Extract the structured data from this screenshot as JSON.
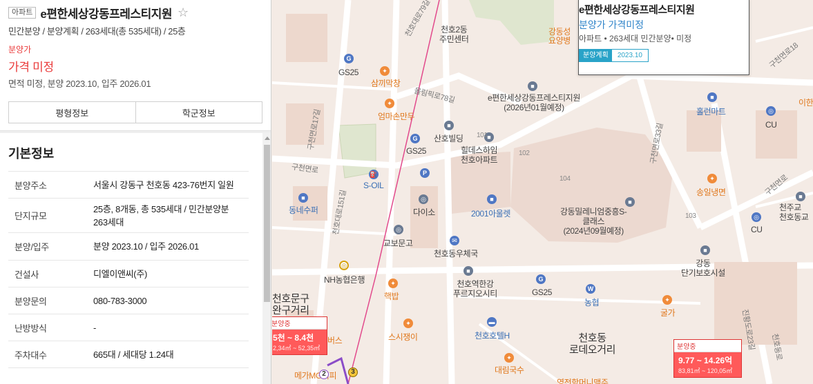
{
  "listing": {
    "type_badge": "아파트",
    "name": "e편한세상강동프레스티지원",
    "star_icon": "☆",
    "summary": "민간분양 / 분양계획 / 263세대(총 535세대) / 25층",
    "sale_label": "분양가",
    "price": "가격 미정",
    "info": "면적 미정, 분양 2023.10, 입주 2026.01"
  },
  "tabs": [
    "평형정보",
    "학군정보"
  ],
  "basic_info": {
    "title": "기본정보",
    "rows": [
      {
        "key": "분양주소",
        "value": "서울시 강동구 천호동 423-76번지 일원"
      },
      {
        "key": "단지규모",
        "value": "25층, 8개동, 총 535세대 / 민간분양분 263세대"
      },
      {
        "key": "분양/입주",
        "value": "분양 2023.10 / 입주 2026.01"
      },
      {
        "key": "건설사",
        "value": "디엘이앤씨(주)"
      },
      {
        "key": "분양문의",
        "value": "080-783-3000"
      },
      {
        "key": "난방방식",
        "value": "-"
      },
      {
        "key": "주차대수",
        "value": "665대 / 세대당 1.24대"
      }
    ]
  },
  "popup": {
    "name": "e편한세상강동프레스티지원",
    "price": "분양가 가격미정",
    "info": "아파트 • 263세대 민간분양• 미정",
    "tag_status": "분양계획",
    "tag_date": "2023.10"
  },
  "markers": [
    {
      "status": "분양중",
      "price": "5천 ~ 8.4천",
      "area": "2,34㎡ ~ 52,35㎡"
    },
    {
      "status": "분양중",
      "price": "9.77 ~ 14.26억",
      "area": "83,81㎡ ~ 120,05㎡"
    }
  ],
  "map_labels": {
    "road_79": "천호대로79길",
    "center_2dong": "천호2동\n주민센터",
    "gangdong_yoyang": "강동성\n요양병",
    "gs25_a": "GS25",
    "samggi": "삼끼막창",
    "olympic_78": "올림픽로78길",
    "site_label": "e편한세상강동프레스티지원\n(2026년01월예정)",
    "eomma": "엄마손만두",
    "sanho": "산호빌딩",
    "gucheon_17": "구천면로17길",
    "hillstate": "힐데스하임\n천호아파트",
    "gs25_b": "GS25",
    "n101": "101",
    "n102": "102",
    "n104": "104",
    "n103": "103",
    "gucheon_rd": "구천면로",
    "soil": "S-OIL",
    "dongne": "동네수퍼",
    "daiso": "다이소",
    "ahul": "2001아울렛",
    "millennium": "강동밀레니엄중흥S-\n클래스\n(2024년09월예정)",
    "gucheon_33": "구천면로33길",
    "cheonho_151": "천호대로151길",
    "kyobo": "교보문고",
    "post": "천호동우체국",
    "nh": "NH농협은행",
    "hanggeup": "핵밥",
    "station": "천호역한강\n푸르지오시티",
    "gs25_c": "GS25",
    "nh_small": "농협",
    "cheonho_munggu": "천호문구\n완구거리",
    "sushi": "스시쟁이",
    "hotel": "천호호텔H",
    "rodeo": "천호동\n로데오거리",
    "daerim": "대림국수",
    "megabox": "메가MG커피",
    "bakery": "버스",
    "gogal": "영전함머니맥주",
    "holion": "홀런마트",
    "cu_a": "CU",
    "ehan": "이한",
    "songil": "송일냉면",
    "cu_b": "CU",
    "cheonju": "천주교\n천호동교",
    "dangi": "강동\n단기보호시설",
    "cheonho_23": "천호대로23길",
    "gulha": "굴가",
    "gucheon_18": "구천면로18",
    "gucheon_rd2": "구천면로",
    "jinwang_23": "진황도로23길",
    "cheonho_gallery": "천호동로"
  },
  "colors": {
    "accent_red": "#ea3b3b",
    "popup_blue": "#2f84c9",
    "tag_teal": "#29a3c8",
    "map_bg": "#f3ece6"
  },
  "icons": {
    "scroll_up": "triangle-up-icon"
  }
}
